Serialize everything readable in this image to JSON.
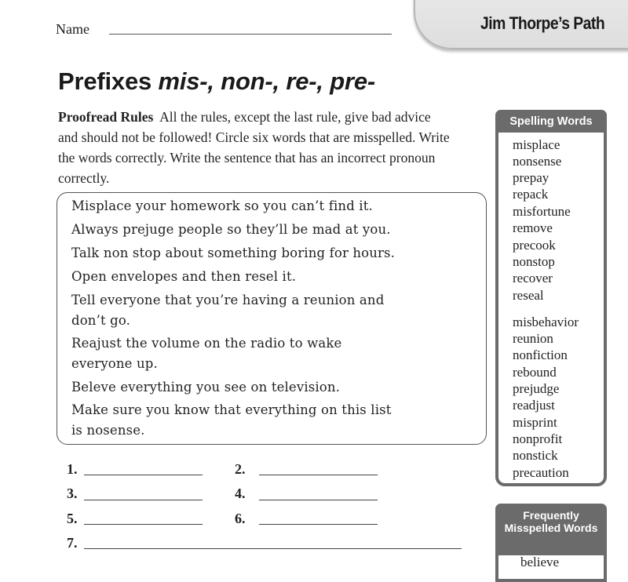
{
  "header": {
    "name_label": "Name",
    "tab_title": "Jim Thorpe’s Path"
  },
  "title": {
    "prefix": "Prefixes ",
    "parts": "mis-, non-, re-, pre-"
  },
  "instructions": {
    "lead": "Proofread Rules",
    "text": "All the rules, except the last rule, give bad advice and should not be followed! Circle six words that are misspelled. Write the words correctly. Write the sentence that has an incorrect pronoun correctly."
  },
  "rules": [
    "Misplace your homework so you can’t find it.",
    "Always prejuge people so they’ll be mad at you.",
    "Talk non stop about something boring for hours.",
    "Open envelopes and then resel it.",
    "Tell everyone that you’re having a reunion and",
    "don’t go.",
    "Reajust the volume on the radio to wake",
    "everyone up.",
    "Beleve everything you see on television.",
    "Make sure you know that everything on this list",
    "is nosense."
  ],
  "answers": [
    "1.",
    "2.",
    "3.",
    "4.",
    "5.",
    "6.",
    "7."
  ],
  "spelling_words": {
    "title": "Spelling Words",
    "group1": [
      "misplace",
      "nonsense",
      "prepay",
      "repack",
      "misfortune",
      "remove",
      "precook",
      "nonstop",
      "recover",
      "reseal"
    ],
    "group2": [
      "misbehavior",
      "reunion",
      "nonfiction",
      "rebound",
      "prejudge",
      "readjust",
      "misprint",
      "nonprofit",
      "nonstick",
      "precaution"
    ]
  },
  "frequently_misspelled": {
    "title": "Frequently Misspelled Words",
    "words": [
      "believe"
    ]
  },
  "colors": {
    "box_header": "#6b6b6b",
    "tab_bg": "#e4e4e4"
  }
}
